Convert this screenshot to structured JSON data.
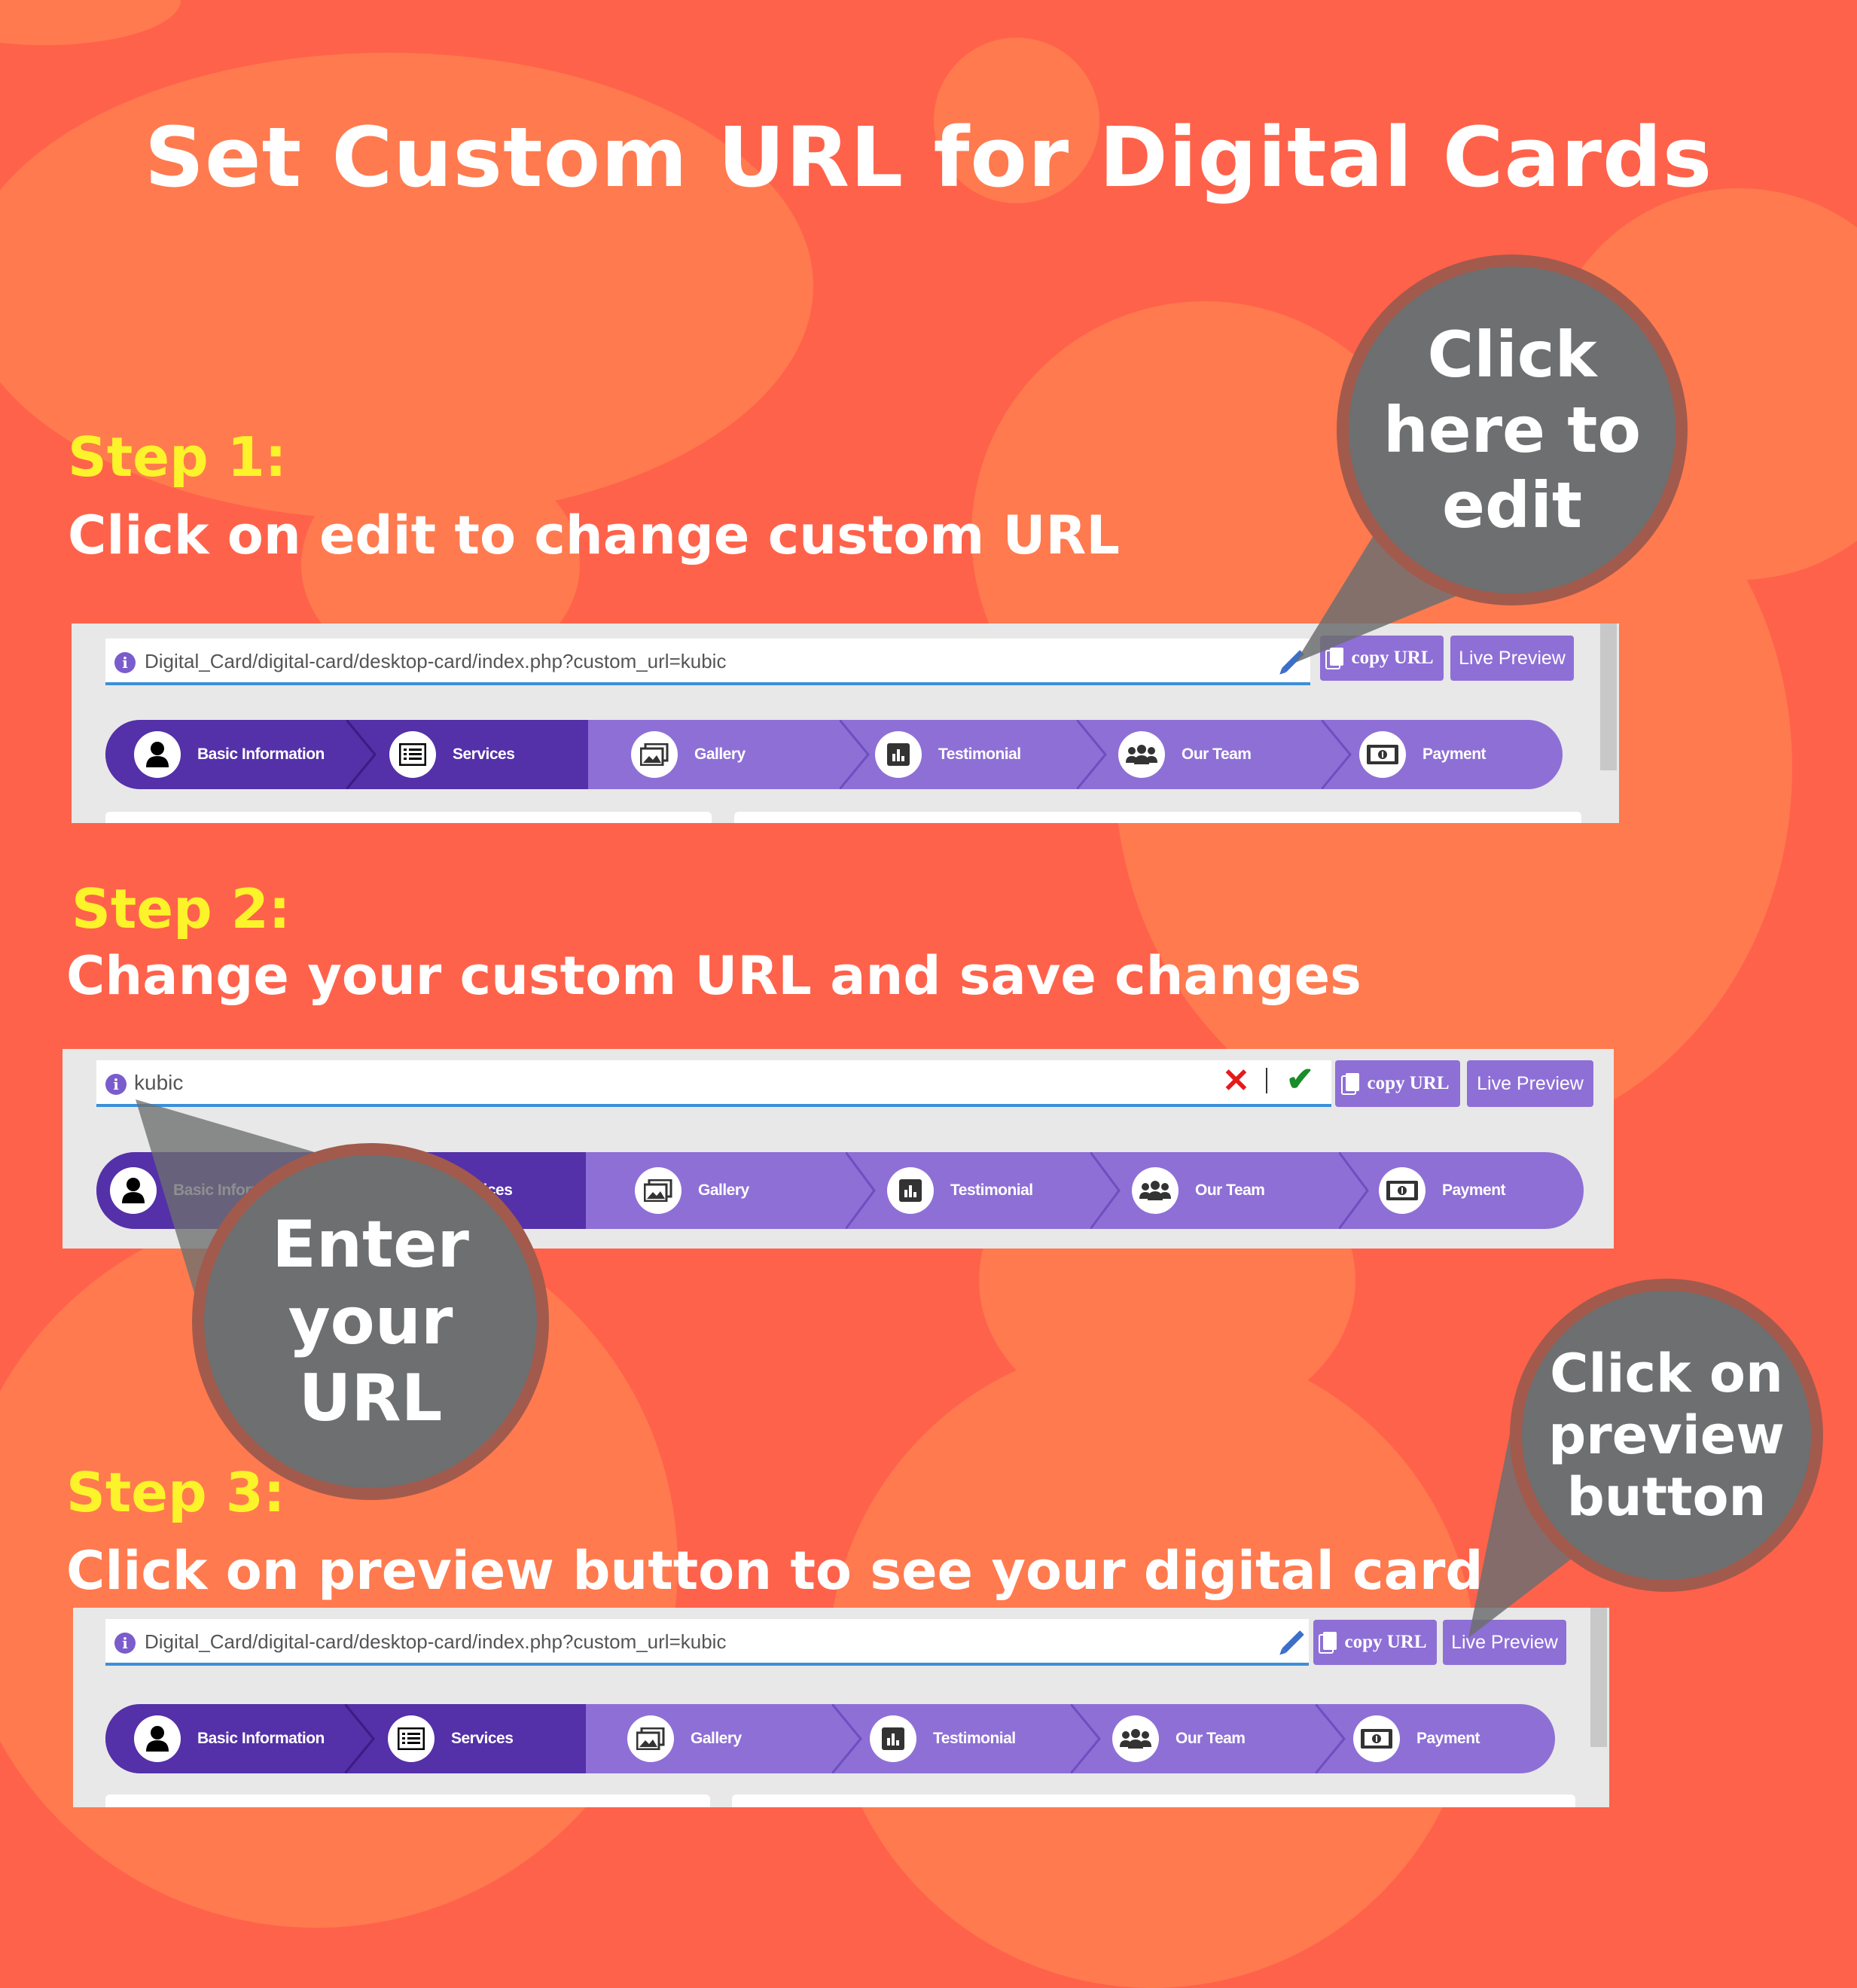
{
  "title": "Set Custom URL for Digital Cards",
  "colors": {
    "background": "#ff624a",
    "blob": "#ff7a4e",
    "step_heading": "#fcf32a",
    "nav_dark": "#5430a9",
    "nav_light": "#8e6fd6",
    "bubble": "#6d6f70",
    "url_underline": "#3b8fd9"
  },
  "steps": [
    {
      "heading": "Step 1:",
      "desc": "Click on edit to change custom URL"
    },
    {
      "heading": "Step 2:",
      "desc": "Change your custom URL and save changes"
    },
    {
      "heading": "Step 3:",
      "desc": "Click on preview button to see your digital card"
    }
  ],
  "callouts": {
    "edit": [
      "Click",
      "here to",
      "edit"
    ],
    "enter": [
      "Enter",
      "your",
      "URL"
    ],
    "preview": [
      "Click on",
      "preview",
      "button"
    ]
  },
  "ui": {
    "url_value": "Digital_Card/digital-card/desktop-card/index.php?custom_url=kubic",
    "edit_value": "kubic",
    "copy_url_label": "copy URL",
    "live_preview_label": "Live Preview",
    "cancel_icon": "x-icon",
    "save_icon": "check-icon",
    "edit_icon": "pencil-icon",
    "info_icon": "info-icon",
    "tabs": [
      {
        "label": "Basic Information",
        "icon": "user-icon",
        "active": true
      },
      {
        "label": "Services",
        "icon": "list-icon",
        "active": true
      },
      {
        "label": "Gallery",
        "icon": "images-icon",
        "active": false
      },
      {
        "label": "Testimonial",
        "icon": "chart-icon",
        "active": false
      },
      {
        "label": "Our Team",
        "icon": "team-icon",
        "active": false
      },
      {
        "label": "Payment",
        "icon": "money-icon",
        "active": false
      }
    ]
  }
}
